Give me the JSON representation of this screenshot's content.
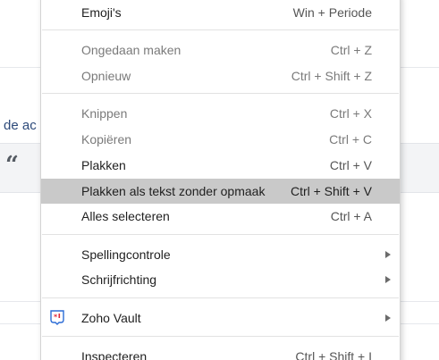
{
  "background": {
    "partial_link_text": "de ac",
    "quote_glyph": "“"
  },
  "menu": {
    "emoji": {
      "label": "Emoji's",
      "shortcut": "Win + Periode"
    },
    "undo": {
      "label": "Ongedaan maken",
      "shortcut": "Ctrl + Z"
    },
    "redo": {
      "label": "Opnieuw",
      "shortcut": "Ctrl + Shift + Z"
    },
    "cut": {
      "label": "Knippen",
      "shortcut": "Ctrl + X"
    },
    "copy": {
      "label": "Kopiëren",
      "shortcut": "Ctrl + C"
    },
    "paste": {
      "label": "Plakken",
      "shortcut": "Ctrl + V"
    },
    "paste_plain": {
      "label": "Plakken als tekst zonder opmaak",
      "shortcut": "Ctrl + Shift + V"
    },
    "select_all": {
      "label": "Alles selecteren",
      "shortcut": "Ctrl + A"
    },
    "spellcheck": {
      "label": "Spellingcontrole"
    },
    "writing_direction": {
      "label": "Schrijfrichting"
    },
    "zoho_vault": {
      "label": "Zoho Vault",
      "icon": "zoho-vault-icon"
    },
    "inspect": {
      "label": "Inspecteren",
      "shortcut": "Ctrl + Shift + I"
    }
  },
  "colors": {
    "highlight": "#c9c9c9",
    "vault_red": "#e0273a",
    "vault_blue": "#2b6cd6"
  }
}
